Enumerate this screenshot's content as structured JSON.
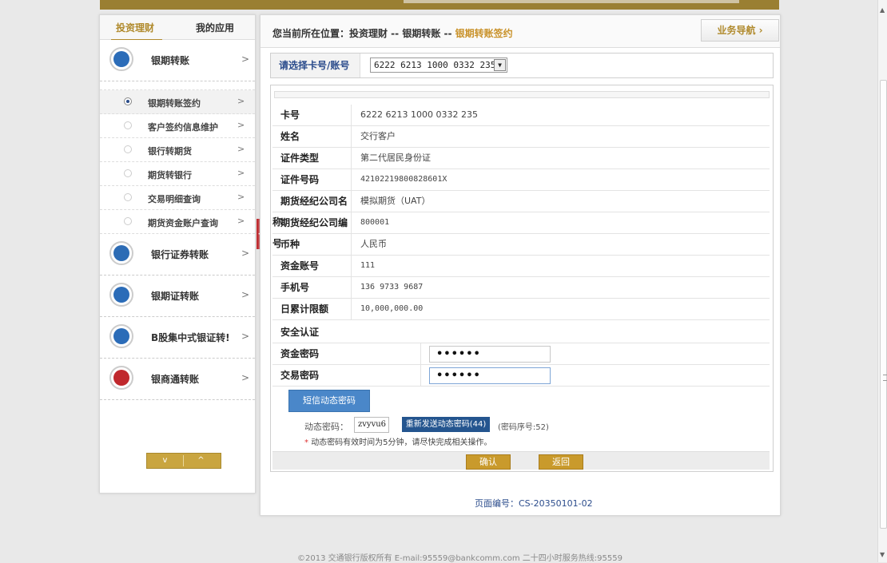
{
  "sidebar": {
    "tabs": [
      "投资理财",
      "我的应用"
    ],
    "groups_top": [
      {
        "label": "银期转账",
        "chevron": ">",
        "color": "#2b6cb8"
      }
    ],
    "subitems": [
      {
        "label": "银期转账签约",
        "chevron": ">"
      },
      {
        "label": "客户签约信息维护",
        "chevron": ">"
      },
      {
        "label": "银行转期货",
        "chevron": ">"
      },
      {
        "label": "期货转银行",
        "chevron": ">"
      },
      {
        "label": "交易明细查询",
        "chevron": ">"
      },
      {
        "label": "期货资金账户查询",
        "chevron": ">"
      }
    ],
    "groups_bottom": [
      {
        "label": "银行证券转账",
        "chevron": ">",
        "color": "#2d6cb5"
      },
      {
        "label": "银期证转账",
        "chevron": ">",
        "color": "#2b6cb8"
      },
      {
        "label": "B股集中式银证转!",
        "chevron": ">",
        "color": "#2b6cb8"
      },
      {
        "label": "银商通转账",
        "chevron": ">",
        "color": "#c0282d"
      }
    ],
    "controls": {
      "down": "v",
      "up": "^"
    },
    "collapse": "<"
  },
  "header": {
    "crumb_prefix": "您当前所在位置：投资理财 -- 银期转账 -- ",
    "crumb_current": "银期转账签约",
    "guide_button": "业务导航 ›"
  },
  "account_select": {
    "label": "请选择卡号/账号",
    "value": "6222 6213 1000 0332 235",
    "arrow": "▼"
  },
  "details": [
    {
      "key": "卡号",
      "value": "6222 6213 1000 0332 235"
    },
    {
      "key": "姓名",
      "value": "交行客户"
    },
    {
      "key": "证件类型",
      "value": "第二代居民身份证"
    },
    {
      "key": "证件号码",
      "value": "42102219800828601X"
    },
    {
      "key": "期货经纪公司名称",
      "value": "模拟期货（UAT）"
    },
    {
      "key": "期货经纪公司编号",
      "value": "800001"
    },
    {
      "key": "币种",
      "value": "人民币"
    },
    {
      "key": "资金账号",
      "value": "111"
    },
    {
      "key": "手机号",
      "value": "136 9733 9687"
    },
    {
      "key": "日累计限额",
      "value": "10,000,000.00"
    }
  ],
  "security": {
    "title": "安全认证",
    "fund_password_label": "资金密码",
    "fund_password_value": "••••••",
    "trade_password_label": "交易密码",
    "trade_password_value": "••••••"
  },
  "sms": {
    "button": "短信动态密码",
    "dynamic_label": "动态密码：",
    "dynamic_value": "zvyvu6",
    "resend": "重新发送动态密码(44)",
    "sequence": "(密码序号:52)",
    "note_star": "*",
    "note": "动态密码有效时间为5分钟，请尽快完成相关操作。"
  },
  "actions": {
    "confirm": "确认",
    "back": "返回"
  },
  "page_number_label": "页面编号：",
  "page_number": "CS-20350101-02",
  "footer": "©2013 交通银行版权所有 E-mail:95559@bankcomm.com 二十四小时服务热线:95559"
}
